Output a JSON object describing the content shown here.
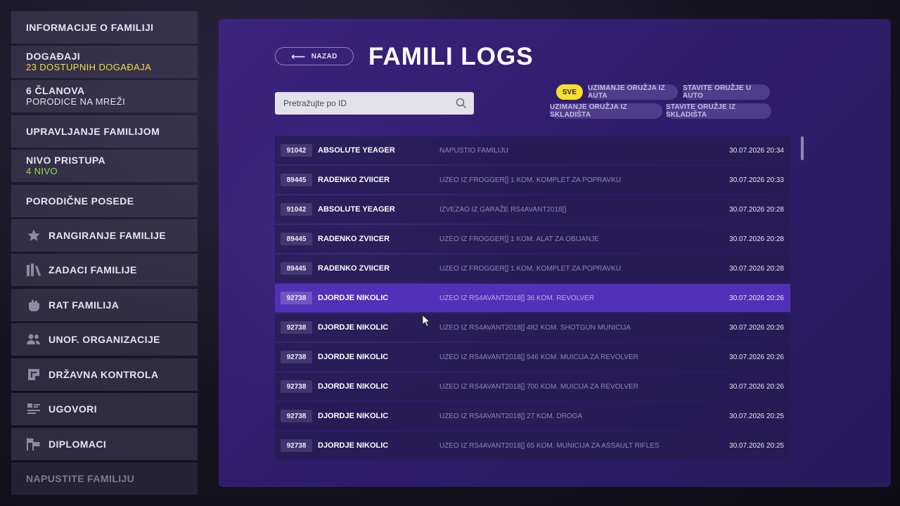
{
  "sidebar": {
    "items": [
      {
        "label": "INFORMACIJE O FAMILIJI"
      },
      {
        "label": "DOGAĐAJI",
        "sub": "23 DOSTUPNIH DOGAĐAJA"
      },
      {
        "label": "6 ČLANOVA",
        "sub": "PORODICE NA MREŽI"
      },
      {
        "label": "UPRAVLJANJE FAMILIJOM"
      },
      {
        "label": "NIVO PRISTUPA",
        "sub": "4 NIVO"
      },
      {
        "label": "PORODIČNE POSEDE"
      },
      {
        "label": "RANGIRANJE FAMILIJE",
        "icon": "star-icon"
      },
      {
        "label": "ZADACI FAMILIJE",
        "icon": "books-icon"
      },
      {
        "label": "RAT FAMILIJA",
        "icon": "fist-icon"
      },
      {
        "label": "UNOF. ORGANIZACIJE",
        "icon": "people-icon"
      },
      {
        "label": "DRŽAVNA KONTROLA",
        "icon": "control-icon"
      },
      {
        "label": "UGOVORI",
        "icon": "contract-list-icon"
      },
      {
        "label": "DIPLOMACI",
        "icon": "flags-icon"
      },
      {
        "label": "NAPUSTITE FAMILIJU"
      }
    ]
  },
  "header": {
    "back_label": "NAZAD",
    "title": "FAMILI LOGS"
  },
  "search": {
    "placeholder": "Pretražujte po ID"
  },
  "filters": [
    {
      "label": "SVE",
      "active": true
    },
    {
      "label": "UZIMANJE ORUŽJA IZ AUTA"
    },
    {
      "label": "STAVITE ORUŽJE U AUTO"
    },
    {
      "label": "UZIMANJE ORUŽJA IZ SKLADIŠTA"
    },
    {
      "label": "STAVITE ORUŽJE IZ SKLADIŠTA"
    }
  ],
  "logs": [
    {
      "id": "91042",
      "name": "ABSOLUTE YEAGER",
      "action": "NAPUSTIO FAMILIJU",
      "time": "30.07.2026 20:34"
    },
    {
      "id": "89445",
      "name": "RADENKO ZVIICER",
      "action": "UZEO IZ FROGGER[] 1 KOM. KOMPLET ZA POPRAVKU",
      "time": "30.07.2026 20:33"
    },
    {
      "id": "91042",
      "name": "ABSOLUTE YEAGER",
      "action": "IZVEZAO IZ GARAŽE RS4AVANT2018[]",
      "time": "30.07.2026 20:28"
    },
    {
      "id": "89445",
      "name": "RADENKO ZVIICER",
      "action": "UZEO IZ FROGGER[] 1 KOM. ALAT ZA OBIJANJE",
      "time": "30.07.2026 20:28"
    },
    {
      "id": "89445",
      "name": "RADENKO ZVIICER",
      "action": "UZEO IZ FROGGER[] 1 KOM. KOMPLET ZA POPRAVKU",
      "time": "30.07.2026 20:28"
    },
    {
      "id": "92738",
      "name": "DJORDJE NIKOLIC",
      "action": "UZEO IZ RS4AVANT2018[] 36 KOM. REVOLVER",
      "time": "30.07.2026 20:26",
      "highlighted": true
    },
    {
      "id": "92738",
      "name": "DJORDJE NIKOLIC",
      "action": "UZEO IZ RS4AVANT2018[] 482 KOM. SHOTGUN MUNICIJA",
      "time": "30.07.2026 20:26"
    },
    {
      "id": "92738",
      "name": "DJORDJE NIKOLIC",
      "action": "UZEO IZ RS4AVANT2018[] 546 KOM. MUICIJA ZA REVOLVER",
      "time": "30.07.2026 20:26"
    },
    {
      "id": "92738",
      "name": "DJORDJE NIKOLIC",
      "action": "UZEO IZ RS4AVANT2018[] 700 KOM. MUICIJA ZA REVOLVER",
      "time": "30.07.2026 20:26"
    },
    {
      "id": "92738",
      "name": "DJORDJE NIKOLIC",
      "action": "UZEO IZ RS4AVANT2018[] 27 KOM. DROGA",
      "time": "30.07.2026 20:25"
    },
    {
      "id": "92738",
      "name": "DJORDJE NIKOLIC",
      "action": "UZEO IZ RS4AVANT2018[] 65 KOM. MUNICIJA ZA ASSAULT RIFLES",
      "time": "30.07.2026 20:25"
    }
  ],
  "colors": {
    "accent_yellow": "#f5e02c",
    "highlight_row": "#5230b8",
    "panel_bg": "#2f1d6b",
    "status_green": "#9de03a"
  }
}
